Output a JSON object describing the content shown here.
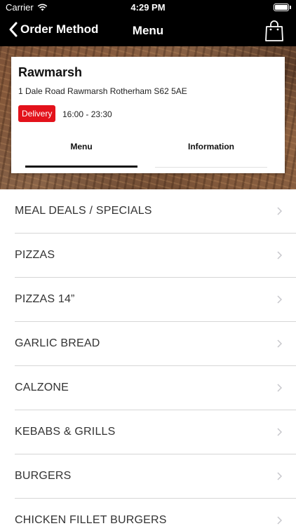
{
  "status_bar": {
    "carrier": "Carrier",
    "time": "4:29 PM"
  },
  "nav": {
    "back_label": "Order Method",
    "title": "Menu",
    "bag_icon": "shopping-bag-icon"
  },
  "restaurant": {
    "name": "Rawmarsh",
    "address": "1 Dale Road Rawmarsh Rotherham S62 5AE",
    "delivery_badge": "Delivery",
    "hours": "16:00 - 23:30",
    "badge_color": "#e3121b"
  },
  "tabs": [
    {
      "label": "Menu",
      "active": true
    },
    {
      "label": "Information",
      "active": false
    }
  ],
  "categories": [
    {
      "label": "MEAL DEALS / SPECIALS"
    },
    {
      "label": "PIZZAS"
    },
    {
      "label": "PIZZAS 14”"
    },
    {
      "label": "GARLIC BREAD"
    },
    {
      "label": "CALZONE"
    },
    {
      "label": "KEBABS & GRILLS"
    },
    {
      "label": "BURGERS"
    },
    {
      "label": "CHICKEN FILLET BURGERS"
    }
  ]
}
